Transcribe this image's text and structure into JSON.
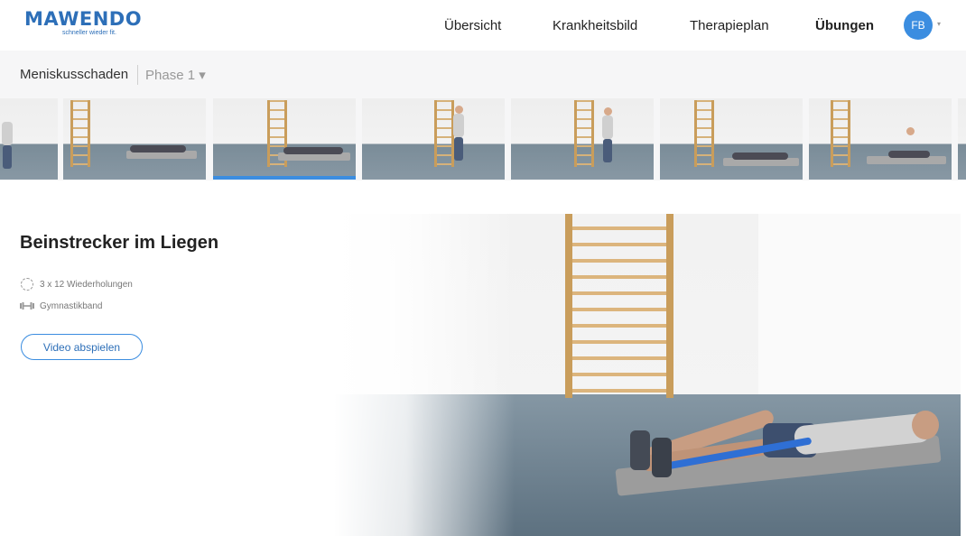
{
  "header": {
    "logo_text": "MAWENDO",
    "logo_tagline": "schneller wieder fit.",
    "nav": [
      "Übersicht",
      "Krankheitsbild",
      "Therapieplan",
      "Übungen"
    ],
    "active_nav": "Übungen",
    "avatar_initials": "FB",
    "avatar_caret": "▾"
  },
  "subbar": {
    "condition": "Meniskusschaden",
    "phase": "Phase 1 ▾"
  },
  "exercise": {
    "title": "Beinstrecker im Liegen",
    "repetitions": "3 x 12 Wiederholungen",
    "equipment": "Gymnastikband",
    "play_button": "Video abspielen"
  },
  "colors": {
    "brand": "#2d6fb8",
    "accent": "#3b8de0"
  },
  "icons": {
    "repetitions": "repeat-circle-icon",
    "equipment": "dumbbell-icon",
    "caret": "chevron-down-icon"
  }
}
